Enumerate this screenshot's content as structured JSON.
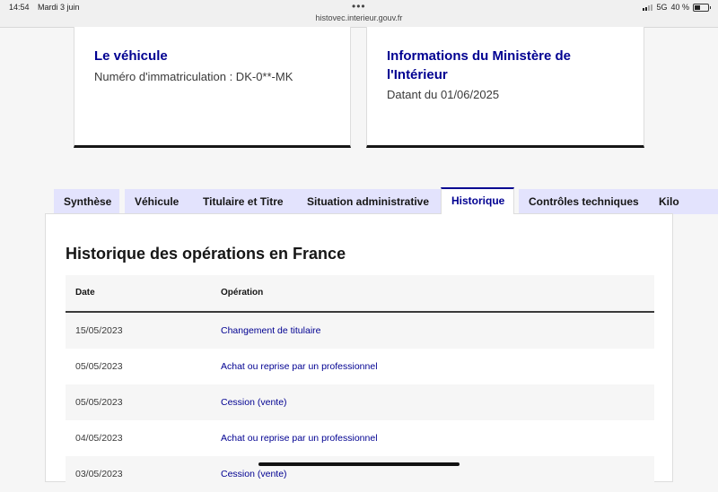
{
  "statusbar": {
    "time": "14:54",
    "date": "Mardi 3 juin",
    "dots": "•••",
    "url": "histovec.interieur.gouv.fr",
    "network": "5G",
    "battery_pct": "40 %",
    "battery_level": 0.4
  },
  "cards": {
    "vehicle": {
      "title": "Le véhicule",
      "text": "Numéro d'immatriculation : DK-0**-MK"
    },
    "ministry": {
      "title": "Informations du Ministère de l'Intérieur",
      "text": "Datant du 01/06/2025"
    }
  },
  "tabs": [
    {
      "label": "Synthèse"
    },
    {
      "label": "Véhicule"
    },
    {
      "label": "Titulaire et Titre"
    },
    {
      "label": "Situation administrative"
    },
    {
      "label": "Historique"
    },
    {
      "label": "Contrôles techniques"
    },
    {
      "label": "Kilo"
    }
  ],
  "history": {
    "title": "Historique des opérations en France",
    "headers": {
      "date": "Date",
      "operation": "Opération"
    },
    "rows": [
      {
        "date": "15/05/2023",
        "operation": "Changement de titulaire"
      },
      {
        "date": "05/05/2023",
        "operation": "Achat ou reprise par un professionnel"
      },
      {
        "date": "05/05/2023",
        "operation": "Cession (vente)"
      },
      {
        "date": "04/05/2023",
        "operation": "Achat ou reprise par un professionnel"
      },
      {
        "date": "03/05/2023",
        "operation": "Cession (vente)"
      }
    ]
  },
  "colors": {
    "accent": "#000091",
    "tab_bg": "#e3e3fd"
  }
}
